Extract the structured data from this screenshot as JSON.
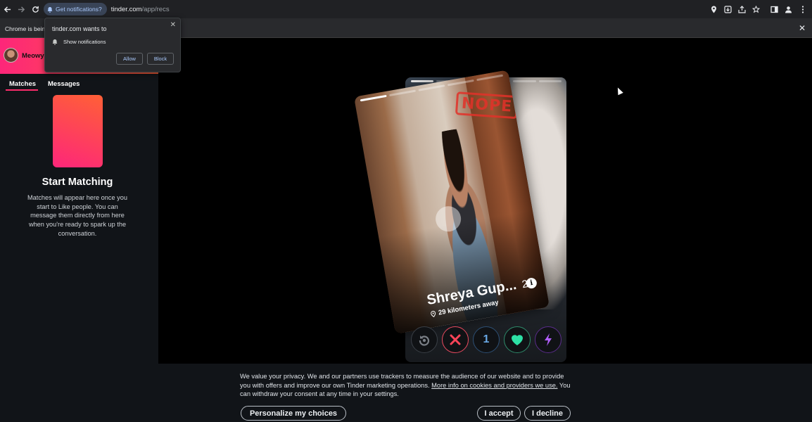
{
  "browser": {
    "permission_chip": "Get notifications?",
    "url_host": "tinder.com",
    "url_path": "/app/recs",
    "infobar_text": "Chrome is being"
  },
  "notification_popup": {
    "title": "tinder.com wants to",
    "permission_label": "Show notifications",
    "allow_label": "Allow",
    "block_label": "Block"
  },
  "sidebar": {
    "username": "Meowya",
    "tabs": [
      {
        "label": "Matches"
      },
      {
        "label": "Messages"
      }
    ],
    "empty_title": "Start Matching",
    "empty_description": "Matches will appear here once you start to Like people. You can message them directly from here when you're ready to spark up the conversation."
  },
  "profile_card": {
    "stamp": "NOPE",
    "name": "Shreya Gup...",
    "age": "23",
    "distance": "29 kilometers away"
  },
  "actions": [
    {
      "name": "rewind",
      "icon": "rewind-icon",
      "color": "#7a7f86"
    },
    {
      "name": "nope",
      "icon": "x-icon",
      "color": "#ff4458"
    },
    {
      "name": "super-like",
      "icon": "star-icon",
      "color": "#3ca4ff",
      "text": "1"
    },
    {
      "name": "like",
      "icon": "heart-icon",
      "color": "#2de0a5"
    },
    {
      "name": "boost",
      "icon": "lightning-icon",
      "color": "#b25fff"
    }
  ],
  "cookie_banner": {
    "text_part1": "We value your privacy. We and our partners use trackers to measure the audience of our website and to provide you with offers and improve our own Tinder marketing operations. ",
    "link_text": "More info on cookies and providers we use.",
    "text_part2": " You can withdraw your consent at any time in your settings.",
    "personalize_label": "Personalize my choices",
    "accept_label": "I accept",
    "decline_label": "I decline"
  }
}
